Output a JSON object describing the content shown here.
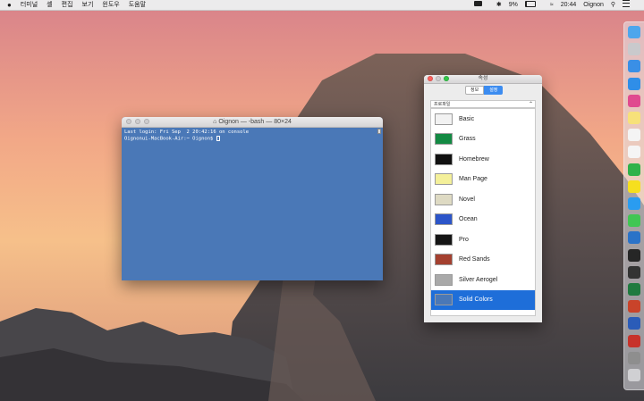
{
  "menubar": {
    "apple": "",
    "items": [
      "터미널",
      "셸",
      "편집",
      "보기",
      "윈도우",
      "도움말"
    ],
    "battery_pct": "9%",
    "time": "20:44",
    "user": "Oignon"
  },
  "terminal": {
    "title": "Oignon — -bash — 80×24",
    "lines": [
      "Last login: Fri Sep  2 20:42:16 on console",
      "Oignonui-MacBook-Air:~ Oignon$ "
    ]
  },
  "inspector": {
    "title": "속성",
    "tabs": [
      {
        "label": "정보"
      },
      {
        "label": "설정"
      }
    ],
    "active_tab": "설정",
    "profile_label": "프로파일",
    "profiles": [
      {
        "name": "Basic",
        "color": "#f2f2f2"
      },
      {
        "name": "Grass",
        "color": "#138a43"
      },
      {
        "name": "Homebrew",
        "color": "#111111"
      },
      {
        "name": "Man Page",
        "color": "#f4f09a"
      },
      {
        "name": "Novel",
        "color": "#dedac3"
      },
      {
        "name": "Ocean",
        "color": "#2c55c9"
      },
      {
        "name": "Pro",
        "color": "#151515"
      },
      {
        "name": "Red Sands",
        "color": "#a4402f"
      },
      {
        "name": "Silver Aerogel",
        "color": "#a9a9a9"
      },
      {
        "name": "Solid Colors",
        "color": "#4a78b7"
      }
    ],
    "selected_profile": "Solid Colors"
  },
  "dock": {
    "icons": [
      {
        "name": "finder-icon",
        "color": "#4ea6ec"
      },
      {
        "name": "launchpad-icon",
        "color": "#c9c9cc"
      },
      {
        "name": "app-store-icon",
        "color": "#3a8fe6"
      },
      {
        "name": "safari-icon",
        "color": "#2f8ee8"
      },
      {
        "name": "itunes-icon",
        "color": "#e04a8f"
      },
      {
        "name": "notes-icon",
        "color": "#f7e17a"
      },
      {
        "name": "calendar-icon",
        "color": "#f4f4f4"
      },
      {
        "name": "photos-icon",
        "color": "#f5f5f5"
      },
      {
        "name": "evernote-icon",
        "color": "#2fb24a"
      },
      {
        "name": "kakaotalk-icon",
        "color": "#f6df1e"
      },
      {
        "name": "chat-icon",
        "color": "#2a9cf0"
      },
      {
        "name": "messages-icon",
        "color": "#41c653"
      },
      {
        "name": "xcode-icon",
        "color": "#2b73c8"
      },
      {
        "name": "terminal-icon",
        "color": "#262626"
      },
      {
        "name": "console-icon",
        "color": "#333333"
      },
      {
        "name": "excel-icon",
        "color": "#1f7a3f"
      },
      {
        "name": "powerpoint-icon",
        "color": "#c9432a"
      },
      {
        "name": "word-icon",
        "color": "#2b5cb8"
      },
      {
        "name": "acrobat-icon",
        "color": "#c7322a"
      },
      {
        "name": "disk-utility-icon",
        "color": "#8e8e8e"
      },
      {
        "name": "trash-icon",
        "color": "#d0d0d3"
      }
    ]
  }
}
